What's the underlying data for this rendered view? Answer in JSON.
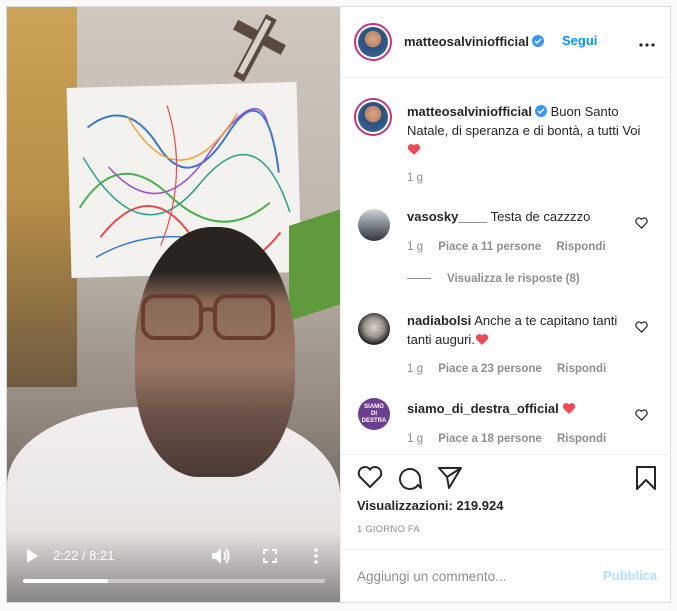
{
  "video": {
    "current_time": "2:22",
    "duration": "8:21",
    "time_label": "2:22 / 8:21",
    "progress": 0.283
  },
  "header": {
    "username": "matteosalviniofficial",
    "follow_label": "Segui"
  },
  "caption": {
    "username": "matteosalviniofficial",
    "text": "Buon Santo Natale, di speranza e di bontà, a tutti Voi",
    "age": "1 g"
  },
  "comments": [
    {
      "username": "vasosky____",
      "text": "Testa de cazzzzo",
      "age": "1 g",
      "likes": "Piace a 11 persone",
      "reply_label": "Rispondi",
      "view_replies": "Visualizza le risposte (8)"
    },
    {
      "username": "nadiabolsi",
      "text": "Anche a te capitano tanti tanti auguri.",
      "age": "1 g",
      "likes": "Piace a 23 persone",
      "reply_label": "Rispondi"
    },
    {
      "username": "siamo_di_destra_official",
      "text": "",
      "age": "1 g",
      "likes": "Piace a 18 persone",
      "reply_label": "Rispondi",
      "avatar_text": "SIAMO DI DESTRA"
    }
  ],
  "stats": {
    "views_label": "Visualizzazioni:",
    "views_value": "219.924",
    "views_full": "Visualizzazioni: 219.924",
    "date": "1 GIORNO FA"
  },
  "comment_box": {
    "placeholder": "Aggiungi un commento...",
    "publish_label": "Pubblica"
  },
  "colors": {
    "accent": "#0095f6",
    "publish_disabled": "#b2dffc",
    "heart_red": "#ed4956",
    "verified": "#3897f0"
  },
  "icons": [
    "play-icon",
    "volume-icon",
    "fullscreen-icon",
    "more-icon",
    "verified-icon",
    "more-options-icon",
    "like-icon",
    "comment-icon",
    "share-icon",
    "save-icon",
    "heart-emoji-icon"
  ]
}
